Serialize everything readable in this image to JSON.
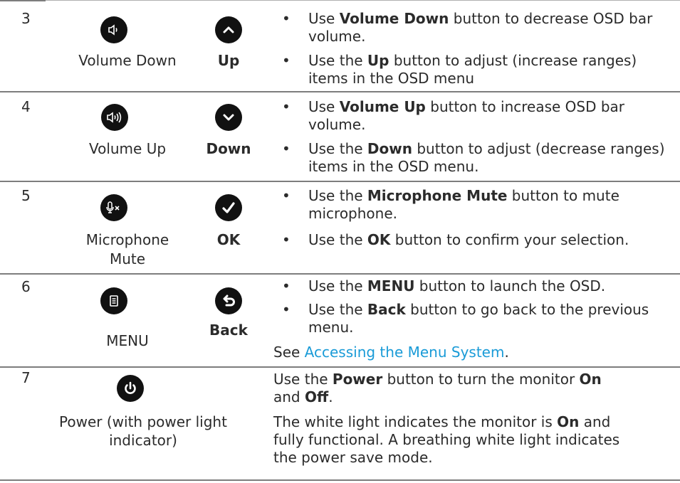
{
  "rows": [
    {
      "num": "3",
      "left_caption": "Volume Down",
      "right_caption": "Up",
      "bullets": [
        {
          "pre": "Use ",
          "bold": "Volume Down",
          "post": " button to decrease OSD bar volume."
        },
        {
          "pre": "Use the ",
          "bold": "Up",
          "post": " button to adjust (increase ranges) items in the OSD menu"
        }
      ]
    },
    {
      "num": "4",
      "left_caption": "Volume Up",
      "right_caption": "Down",
      "bullets": [
        {
          "pre": "Use ",
          "bold": "Volume Up",
          "post": " button to increase OSD bar volume."
        },
        {
          "pre": "Use the ",
          "bold": "Down",
          "post": " button to adjust (decrease ranges) items in the OSD menu."
        }
      ]
    },
    {
      "num": "5",
      "left_caption_1": "Microphone",
      "left_caption_2": "Mute",
      "right_caption": "OK",
      "bullets": [
        {
          "pre": "Use the ",
          "bold": "Microphone Mute",
          "post": " button to mute microphone."
        },
        {
          "pre": "Use the ",
          "bold": "OK",
          "post": " button to confirm your selection."
        }
      ]
    },
    {
      "num": "6",
      "left_caption": "MENU",
      "right_caption": "Back",
      "bullets": [
        {
          "pre": "Use the ",
          "bold": "MENU",
          "post": " button to launch the OSD."
        },
        {
          "pre": "Use the ",
          "bold": "Back",
          "post": " button to go back to the previous menu."
        }
      ],
      "see_pre": "See ",
      "see_link": "Accessing the Menu System",
      "see_post": "."
    },
    {
      "num": "7",
      "left_caption_1": "Power (with power light",
      "left_caption_2": "indicator)",
      "p1_pre": "Use the ",
      "p1_bold1": "Power",
      "p1_mid": " button to turn the monitor ",
      "p1_bold2": "On",
      "p1_and": "and ",
      "p1_bold3": "Off",
      "p1_post": ".",
      "p2_pre": "The white light indicates the monitor is ",
      "p2_bold": "On",
      "p2_post": " and",
      "p2_line2": "fully functional. A breathing white light indicates",
      "p2_line3": "the power save mode."
    }
  ],
  "bullet_char": "•",
  "link_color": "#1a9bd7",
  "icon_names": [
    "volume-down-icon",
    "up-arrow-icon",
    "volume-up-icon",
    "down-arrow-icon",
    "microphone-mute-icon",
    "ok-check-icon",
    "menu-icon",
    "back-icon",
    "power-icon"
  ]
}
